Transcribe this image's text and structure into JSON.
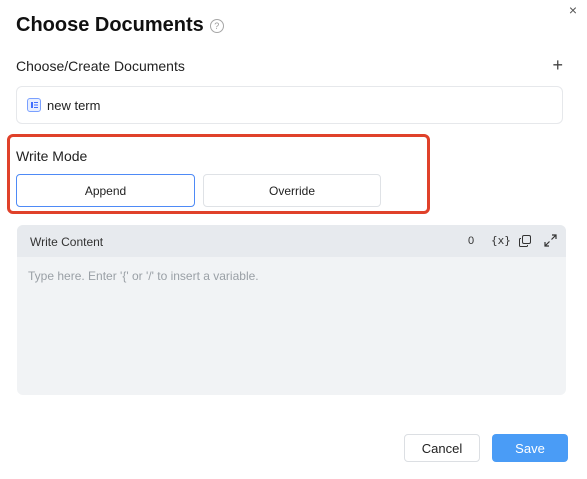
{
  "dialog": {
    "title": "Choose Documents",
    "help_icon": "?",
    "close_icon": "×"
  },
  "documents": {
    "label": "Choose/Create Documents",
    "add_icon": "+",
    "items": [
      {
        "name": "new term",
        "icon": "doc-icon"
      }
    ]
  },
  "write_mode": {
    "label": "Write Mode",
    "options": [
      "Append",
      "Override"
    ],
    "selected": "Append"
  },
  "write_content": {
    "label": "Write Content",
    "count": "0",
    "variable_icon": "{x}",
    "value": "",
    "placeholder": "Type here. Enter '{' or '/' to insert a variable."
  },
  "footer": {
    "cancel_label": "Cancel",
    "save_label": "Save"
  },
  "colors": {
    "accent": "#4a9cf6",
    "highlight": "#e0412a"
  }
}
